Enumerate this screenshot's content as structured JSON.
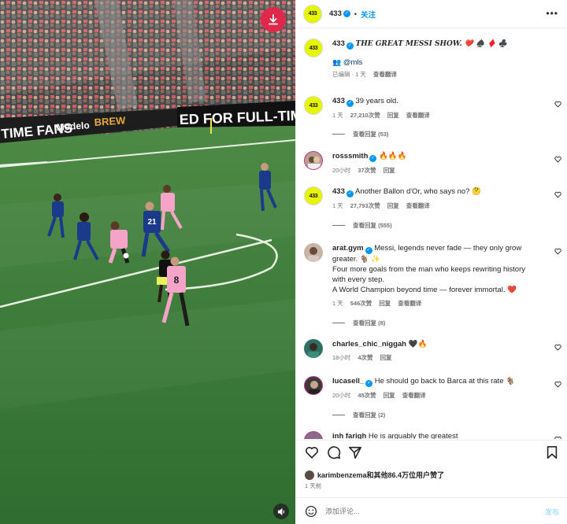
{
  "header": {
    "username": "433",
    "separator": "•",
    "follow_label": "关注",
    "more_label": "•••"
  },
  "caption": {
    "username": "433",
    "text": "THE GREAT MESSI SHOW. ❤️ ♠️ ♦️ ♣️",
    "mention": "@mls",
    "edited": "已编辑 · 1 天",
    "translate": "查看翻译"
  },
  "comments": [
    {
      "username": "433",
      "verified": true,
      "text": "39 years old.",
      "time": "1 天",
      "likes": "27,210次赞",
      "reply": "回复",
      "translate": "查看翻译",
      "view_replies": "查看回复 (53)"
    },
    {
      "username": "rosssmith",
      "verified": true,
      "text": "🔥🔥🔥",
      "time": "20小时",
      "likes": "37次赞",
      "reply": "回复"
    },
    {
      "username": "433",
      "verified": true,
      "text": "Another Ballon d'Or, who says no? 🤔",
      "time": "1 天",
      "likes": "27,793次赞",
      "reply": "回复",
      "translate": "查看翻译",
      "view_replies": "查看回复 (555)"
    },
    {
      "username": "arat.gym",
      "verified": true,
      "text_lines": [
        "Messi, legends never fade — they only grow",
        "greater. 🐐 ✨",
        "Four more goals from the man who keeps rewriting history",
        "with every step.",
        "A World Champion beyond time — forever immortal. ❤️"
      ],
      "time": "1 天",
      "likes": "546次赞",
      "reply": "回复",
      "translate": "查看翻译",
      "view_replies": "查看回复 (8)"
    },
    {
      "username": "charles_chic_niggah",
      "verified": false,
      "text": "🖤🔥",
      "time": "18小时",
      "likes": "4次赞",
      "reply": "回复"
    },
    {
      "username": "lucasell_",
      "verified": true,
      "text": "He should go back to Barca at this rate 🐐",
      "time": "20小时",
      "likes": "45次赞",
      "reply": "回复",
      "translate": "查看翻译",
      "view_replies": "查看回复 (2)"
    },
    {
      "username": "inh farigh",
      "verified": false,
      "text": "He is arguably the greatest"
    }
  ],
  "likes": {
    "prefix": "karimbenzema和其他",
    "count": "86.4万位用户",
    "suffix": "赞了"
  },
  "posted_time": "1 天前",
  "comment_input": {
    "placeholder": "添加评论..."
  },
  "post_label": "发布",
  "media": {
    "banner_left": "TIME FANS",
    "banner_mid": "Modelo",
    "banner_right_prefix": "BREW",
    "banner_big": "ED FOR FULL-TIME FA",
    "jersey_numbers": [
      "21",
      "8"
    ]
  },
  "colors": {
    "accent": "#0095f6",
    "download_button": "#e0294a",
    "logo": "#e6f500",
    "heart": "#ed4956",
    "pitch": "#3d7a3a"
  },
  "icons": {
    "download": "download-icon",
    "mute": "speaker-icon",
    "like": "heart-icon",
    "comment": "comment-icon",
    "share": "share-icon",
    "save": "bookmark-icon"
  }
}
